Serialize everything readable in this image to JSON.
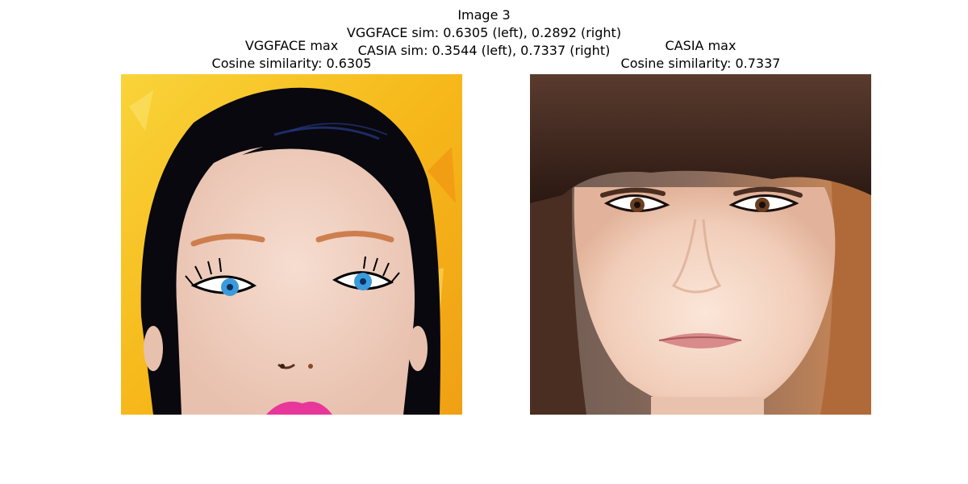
{
  "figure": {
    "suptitle_lines": [
      "Image 3",
      "VGGFACE sim: 0.6305 (left), 0.2892 (right)",
      "CASIA sim: 0.3544 (left), 0.7337 (right)"
    ]
  },
  "panels": [
    {
      "title_line1": "VGGFACE max",
      "title_line2": "Cosine similarity: 0.6305",
      "image_description": "illustrated-woman-face"
    },
    {
      "title_line1": "CASIA max",
      "title_line2": "Cosine similarity: 0.7337",
      "image_description": "photo-woman-face"
    }
  ],
  "colors": {
    "background": "#ffffff",
    "left_bg_yellow": "#f7c21c",
    "left_hair": "#0a0a10",
    "left_skin": "#f1d3c4",
    "left_lips": "#e8379a",
    "left_eyes": "#3a9bdc",
    "right_hair": "#3b231c",
    "right_skin": "#f4d6c6",
    "right_bg": "#c9825a"
  }
}
